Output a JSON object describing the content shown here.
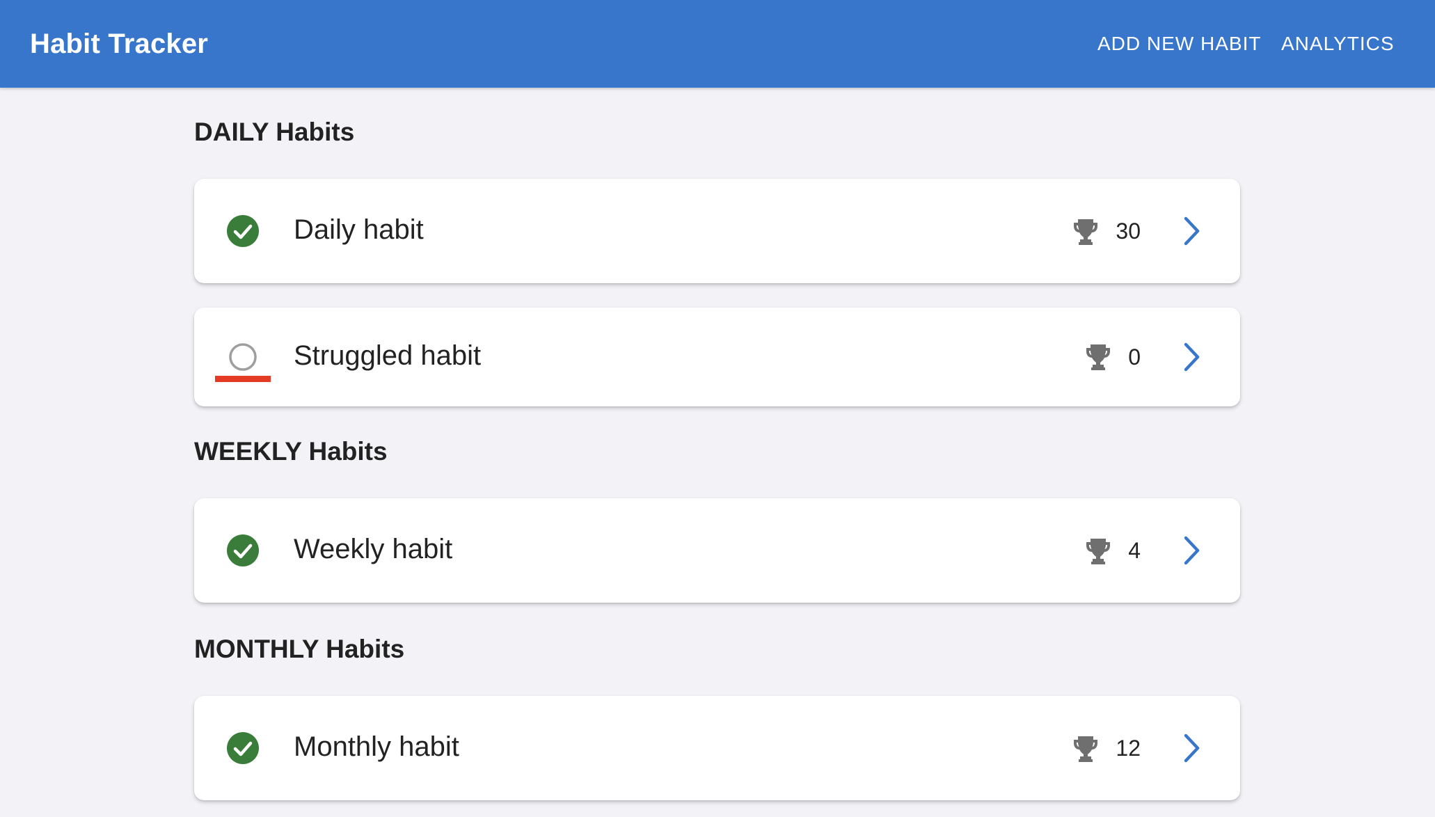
{
  "app": {
    "title": "Habit Tracker",
    "nav": {
      "add_label": "ADD NEW HABIT",
      "analytics_label": "ANALYTICS"
    }
  },
  "colors": {
    "app_bar": "#3876cc",
    "completed": "#3a7d3a",
    "pending_ring": "#9e9e9e",
    "struggle_bar": "#e53a23",
    "chevron": "#3876cc",
    "trophy": "#6f6f6f"
  },
  "sections": [
    {
      "title": "DAILY Habits",
      "habits": [
        {
          "name": "Daily habit",
          "completed": true,
          "struggling": false,
          "count": "30",
          "status_icon": "check-circle-icon",
          "trophy_icon": "trophy-icon",
          "nav_icon": "chevron-right-icon"
        },
        {
          "name": "Struggled habit",
          "completed": false,
          "struggling": true,
          "count": "0",
          "status_icon": "empty-circle-icon",
          "trophy_icon": "trophy-icon",
          "nav_icon": "chevron-right-icon"
        }
      ]
    },
    {
      "title": "WEEKLY Habits",
      "habits": [
        {
          "name": "Weekly habit",
          "completed": true,
          "struggling": false,
          "count": "4",
          "status_icon": "check-circle-icon",
          "trophy_icon": "trophy-icon",
          "nav_icon": "chevron-right-icon"
        }
      ]
    },
    {
      "title": "MONTHLY Habits",
      "habits": [
        {
          "name": "Monthly habit",
          "completed": true,
          "struggling": false,
          "count": "12",
          "status_icon": "check-circle-icon",
          "trophy_icon": "trophy-icon",
          "nav_icon": "chevron-right-icon"
        }
      ]
    }
  ]
}
